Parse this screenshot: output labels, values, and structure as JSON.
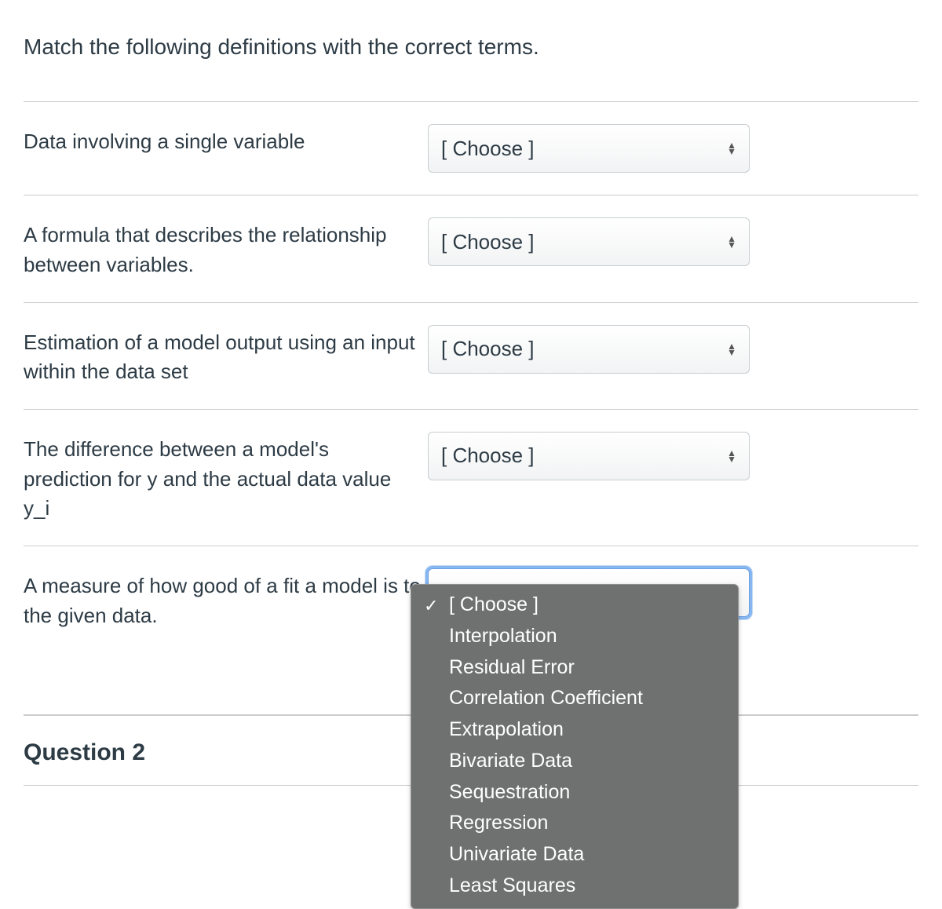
{
  "instructions": "Match the following definitions with the correct terms.",
  "choose_placeholder": "[ Choose ]",
  "rows": [
    {
      "prompt": "Data involving a single variable"
    },
    {
      "prompt": "A formula that describes the relationship between variables."
    },
    {
      "prompt": "Estimation of a model output using an input within the data set"
    },
    {
      "prompt": "The difference between a model's prediction for y and the actual data value y_i"
    },
    {
      "prompt": "A measure of how good of a fit a model is to the given data."
    }
  ],
  "dropdown_options": [
    "[ Choose ]",
    "Interpolation",
    "Residual Error",
    "Correlation Coefficient",
    "Extrapolation",
    "Bivariate Data",
    "Sequestration",
    "Regression",
    "Univariate Data",
    "Least Squares"
  ],
  "next_question_label": "Question 2"
}
